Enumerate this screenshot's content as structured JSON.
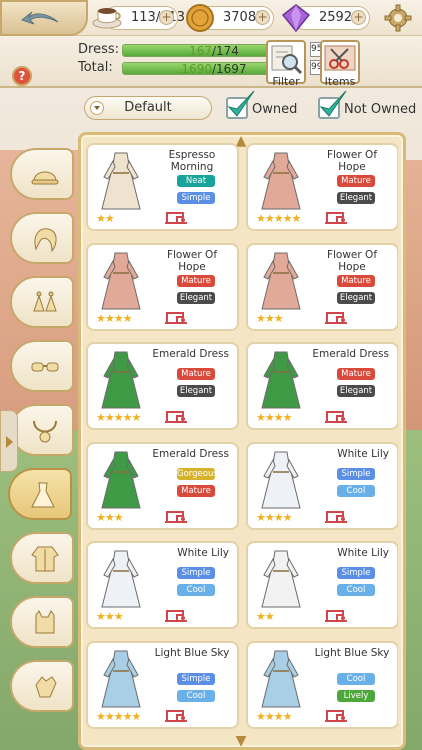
{
  "top_bar": {
    "stamina": "113/113",
    "coins": "37082",
    "diamonds": "25920",
    "plus": "+"
  },
  "stats": {
    "dress_label": "Dress:",
    "dress_current": "167",
    "dress_total": "/174",
    "dress_percent": "95.9%",
    "dress_fill": 0.96,
    "total_label": "Total:",
    "total_current": "1690",
    "total_total": "/1697",
    "total_percent": "99.5%",
    "total_fill": 0.995,
    "help": "?"
  },
  "tools": {
    "filter_label": "Filter",
    "items_label": "Items"
  },
  "filter": {
    "sort_value": "Default",
    "owned_label": "Owned",
    "not_owned_label": "Not Owned"
  },
  "categories": [
    {
      "icon": "hat-icon"
    },
    {
      "icon": "hair-icon"
    },
    {
      "icon": "earrings-icon"
    },
    {
      "icon": "glasses-icon"
    },
    {
      "icon": "necklace-icon"
    },
    {
      "icon": "dress-icon",
      "active": true
    },
    {
      "icon": "coat-icon"
    },
    {
      "icon": "top-icon"
    },
    {
      "icon": "gloves-icon"
    }
  ],
  "items": [
    {
      "name": "Espresso Morning",
      "tags": [
        "Neat",
        "Simple"
      ],
      "stars": "★★",
      "color": "#efe3d0"
    },
    {
      "name": "Flower Of Hope",
      "tags": [
        "Mature",
        "Elegant"
      ],
      "stars": "★★★★★",
      "color": "#e3a998"
    },
    {
      "name": "Flower Of Hope",
      "tags": [
        "Mature",
        "Elegant"
      ],
      "stars": "★★★★",
      "color": "#e3a998"
    },
    {
      "name": "Flower Of Hope",
      "tags": [
        "Mature",
        "Elegant"
      ],
      "stars": "★★★",
      "color": "#e3a998"
    },
    {
      "name": "Emerald Dress",
      "tags": [
        "Mature",
        "Elegant"
      ],
      "stars": "★★★★★",
      "color": "#3f9a45"
    },
    {
      "name": "Emerald Dress",
      "tags": [
        "Mature",
        "Elegant"
      ],
      "stars": "★★★★",
      "color": "#3f9a45"
    },
    {
      "name": "Emerald Dress",
      "tags": [
        "Gorgeous",
        "Mature"
      ],
      "stars": "★★★",
      "color": "#3f9a45"
    },
    {
      "name": "White Lily",
      "tags": [
        "Simple",
        "Cool"
      ],
      "stars": "★★★★",
      "color": "#eef1f6"
    },
    {
      "name": "White Lily",
      "tags": [
        "Simple",
        "Cool"
      ],
      "stars": "★★★",
      "color": "#eef1f6"
    },
    {
      "name": "White Lily",
      "tags": [
        "Simple",
        "Cool"
      ],
      "stars": "★★",
      "color": "#f2f2f2"
    },
    {
      "name": "Light Blue Sky",
      "tags": [
        "Simple",
        "Cool"
      ],
      "stars": "★★★★★",
      "color": "#a9cfe6"
    },
    {
      "name": "Light Blue Sky",
      "tags": [
        "Cool",
        "Lively"
      ],
      "stars": "★★★★",
      "color": "#a9cfe6"
    }
  ],
  "tag_colors": {
    "Neat": "#1aa39a",
    "Simple": "#5b8fe6",
    "Mature": "#d94a3a",
    "Elegant": "#4b4b4b",
    "Cool": "#6ab0e8",
    "Gorgeous": "#d5b22a",
    "Lively": "#4ea73a"
  }
}
